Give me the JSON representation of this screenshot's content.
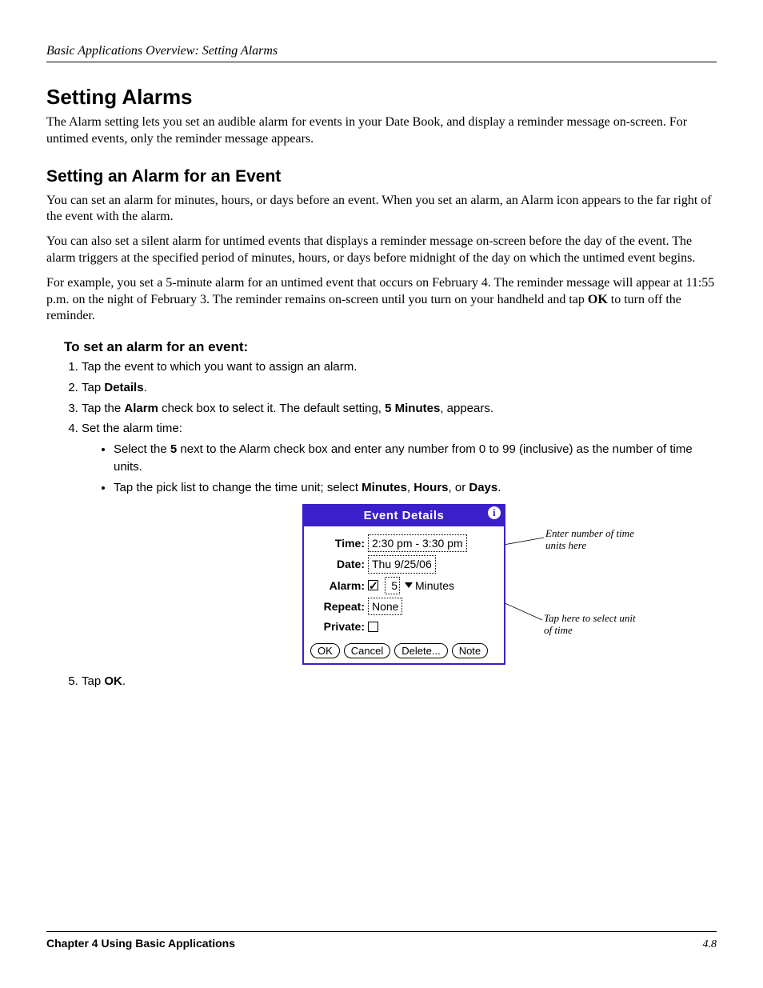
{
  "header": {
    "running": "Basic Applications Overview: Setting Alarms"
  },
  "h1": "Setting Alarms",
  "intro": "The Alarm setting lets you set an audible alarm for events in your Date Book, and display a reminder message on-screen. For untimed events, only the reminder message appears.",
  "h2": "Setting an Alarm for an Event",
  "p1": "You can set an alarm for minutes, hours, or days before an event. When you set an alarm, an Alarm icon appears to the far right of the event with the alarm.",
  "p2": "You can also set a silent alarm for untimed events that displays a reminder message on-screen before the day of the event. The alarm triggers at the specified period of minutes, hours, or days before midnight of the day on which the untimed event begins.",
  "p3a": "For example, you set a 5-minute alarm for an untimed event that occurs on February 4. The reminder message will appear at 11:55 p.m. on the night of February 3. The reminder remains on-screen until you turn on your handheld and tap ",
  "p3b": "OK",
  "p3c": " to turn off the reminder.",
  "task_title": "To set an alarm for an event:",
  "steps": {
    "s1": "Tap the event to which you want to assign an alarm.",
    "s2a": "Tap ",
    "s2b": "Details",
    "s2c": ".",
    "s3a": "Tap the ",
    "s3b": "Alarm",
    "s3c": " check box to select it. The default setting, ",
    "s3d": "5 Minutes",
    "s3e": ", appears.",
    "s4": "Set the alarm time:",
    "s4_1a": "Select the ",
    "s4_1b": "5",
    "s4_1c": " next to the Alarm check box and enter any number from 0 to 99 (inclusive) as the number of time units.",
    "s4_2a": "Tap the pick list to change the time unit; select ",
    "s4_2b": "Minutes",
    "s4_2c": ", ",
    "s4_2d": "Hours",
    "s4_2e": ", or ",
    "s4_2f": "Days",
    "s4_2g": ".",
    "s5a": "Tap ",
    "s5b": "OK",
    "s5c": "."
  },
  "dialog": {
    "title": "Event Details",
    "info_glyph": "i",
    "rows": {
      "time_label": "Time:",
      "time_value": "2:30 pm - 3:30 pm",
      "date_label": "Date:",
      "date_value": "Thu 9/25/06",
      "alarm_label": "Alarm:",
      "alarm_number": "5",
      "alarm_unit": "Minutes",
      "repeat_label": "Repeat:",
      "repeat_value": "None",
      "private_label": "Private:"
    },
    "buttons": {
      "ok": "OK",
      "cancel": "Cancel",
      "delete": "Delete...",
      "note": "Note"
    }
  },
  "callouts": {
    "top": "Enter number of time units here",
    "bottom": "Tap here to select unit of time"
  },
  "footer": {
    "left": "Chapter 4 Using Basic Applications",
    "right": "4.8"
  }
}
